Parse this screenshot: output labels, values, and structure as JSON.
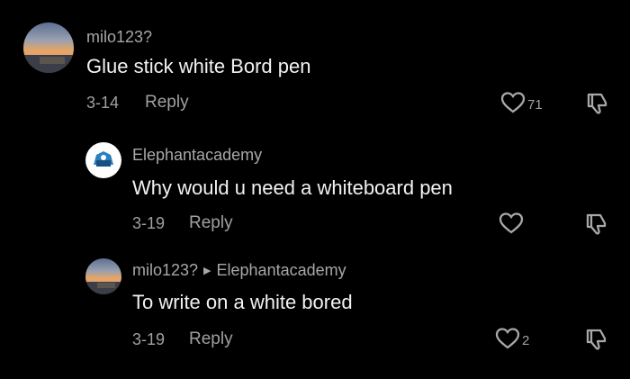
{
  "comments": [
    {
      "user": "milo123?",
      "text": "Glue stick white Bord pen",
      "date": "3-14",
      "reply_label": "Reply",
      "likes": "71"
    },
    {
      "user": "Elephantacademy",
      "text": "Why would u need a whiteboard pen",
      "date": "3-19",
      "reply_label": "Reply",
      "likes": ""
    },
    {
      "user": "milo123?",
      "reply_to": "Elephantacademy",
      "text": "To write on a white bored",
      "date": "3-19",
      "reply_label": "Reply",
      "likes": "2"
    }
  ],
  "icons": {
    "like": "heart-outline-icon",
    "dislike": "thumbs-down-icon",
    "reply_arrow": "right-triangle-icon"
  },
  "colors": {
    "background": "#000000",
    "username": "#a7a7a7",
    "text": "#f2f2f2",
    "meta": "#a0a0a0"
  }
}
